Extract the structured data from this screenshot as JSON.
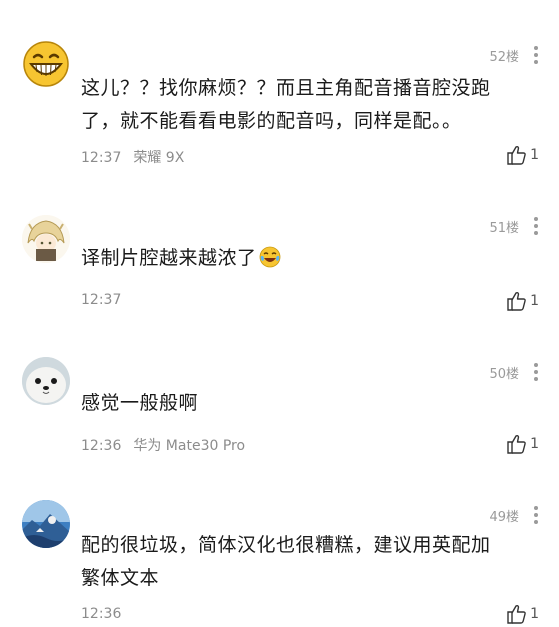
{
  "comments": [
    {
      "floor": "52楼",
      "text_line1": "这儿？？找你麻烦？？而且主角配音播音腔没跑",
      "text_line2": "了，就不能看看电影的配音吗，同样是配。。",
      "time": "12:37",
      "device": "荣耀 9X",
      "likes": "1",
      "avatar": "grinning-emoji-avatar"
    },
    {
      "floor": "51楼",
      "text_line1": "译制片腔越来越浓了",
      "inline_emoji": "tears-of-joy-emoji",
      "time": "12:37",
      "device": "",
      "likes": "1",
      "avatar": "anime-character-avatar"
    },
    {
      "floor": "50楼",
      "text_line1": "感觉一般般啊",
      "time": "12:36",
      "device": "华为 Mate30 Pro",
      "likes": "1",
      "avatar": "seal-pup-avatar"
    },
    {
      "floor": "49楼",
      "text_line1": "配的很垃圾，简体汉化也很糟糕，建议用英配加",
      "text_line2": "繁体文本",
      "time": "12:36",
      "device": "",
      "likes": "1",
      "avatar": "landscape-photo-avatar"
    }
  ]
}
